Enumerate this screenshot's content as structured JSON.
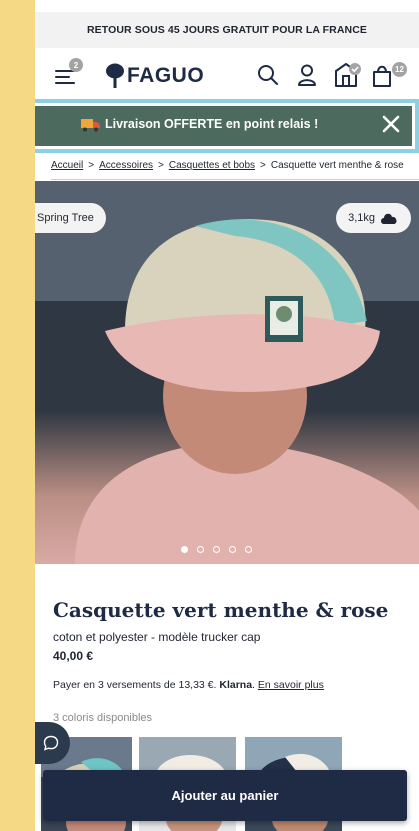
{
  "promo_bar": {
    "text": "RETOUR SOUS 45 JOURS GRATUIT POUR LA FRANCE"
  },
  "header": {
    "menu_badge": "2",
    "logo_text": "FAGUO",
    "cart_badge": "12"
  },
  "delivery_banner": {
    "text": "Livraison OFFERTE en point relais !"
  },
  "breadcrumb": {
    "items": [
      "Accueil",
      "Accessoires",
      "Casquettes et bobs",
      "Casquette vert menthe & rose"
    ],
    "separator": ">"
  },
  "gallery": {
    "tag_left": "Spring Tree",
    "tag_right": "3,1kg",
    "dots": 5,
    "active_dot": 0
  },
  "product": {
    "title": "Casquette vert menthe & rose",
    "subtitle": "coton et polyester - modèle trucker cap",
    "price": "40,00 €",
    "installments_text": "Payer en 3 versements de 13,33 €.",
    "klarna": "Klarna",
    "learn_more": "En savoir plus",
    "colors_label": "3 coloris disponibles"
  },
  "cta": {
    "label": "Ajouter au panier"
  },
  "colors": {
    "page_bg": "#f6d985",
    "navy": "#1f2a44",
    "banner_green": "#4c6a5d",
    "highlight": "#8dd0e2"
  }
}
